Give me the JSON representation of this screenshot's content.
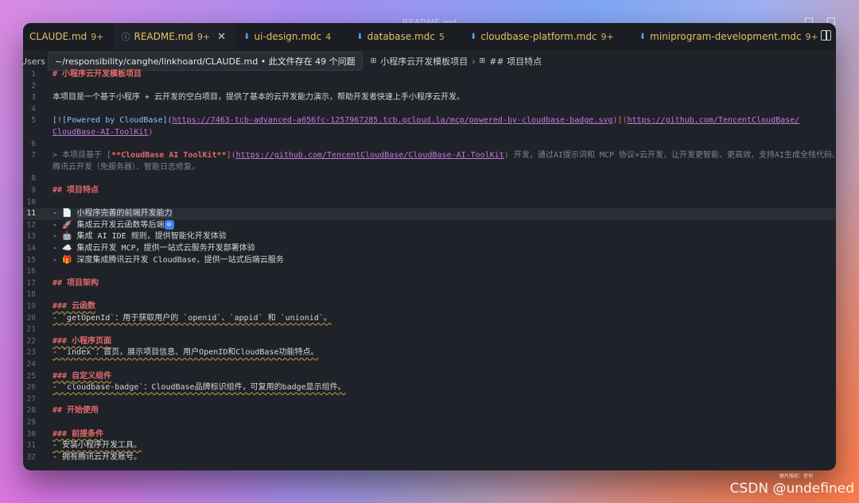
{
  "window_title": "README.md",
  "tabs": [
    {
      "name": "CLAUDE.md",
      "count": "9+",
      "active": false,
      "icon": "markdown-icon"
    },
    {
      "name": "README.md",
      "count": "9+",
      "active": true,
      "icon": "info-icon"
    },
    {
      "name": "ui-design.mdc",
      "count": "4",
      "active": false,
      "icon": "markdown-icon"
    },
    {
      "name": "database.mdc",
      "count": "5",
      "active": false,
      "icon": "markdown-icon"
    },
    {
      "name": "cloudbase-platform.mdc",
      "count": "9+",
      "active": false,
      "icon": "markdown-icon"
    },
    {
      "name": "miniprogram-development.mdc",
      "count": "9+",
      "active": false,
      "icon": "markdown-icon"
    }
  ],
  "breadcrumb": {
    "users": "Users",
    "tooltip": "~/responsibility/canghe/linkhoard/CLAUDE.md • 此文件存在 49 个问题",
    "crumb1": "小程序云开发模板项目",
    "crumb2": "## 项目特点"
  },
  "lines": [
    {
      "n": "1",
      "t": "# 小程序云开发模板项目"
    },
    {
      "n": "2",
      "t": ""
    },
    {
      "n": "3",
      "t": "本项目是一个基于小程序 + 云开发的空白项目，提供了基本的云开发能力演示，帮助开发者快速上手小程序云开发。"
    },
    {
      "n": "4",
      "t": ""
    },
    {
      "n": "5",
      "a": "[![Powered by CloudBase](",
      "b": "https://7463-tcb-advanced-a656fc-1257967285.tcb.qcloud.la/mcp/powered-by-cloudbase-badge.svg",
      "c": ")](",
      "d": "https://github.com/TencentCloudBase/"
    },
    {
      "n": "",
      "d": "CloudBase-AI-ToolKit",
      "c": ")"
    },
    {
      "n": "6",
      "t": ""
    },
    {
      "n": "7",
      "a": "> 本项目基于 [",
      "b": "**CloudBase AI ToolKit**",
      "c": "](",
      "d": "https://github.com/TencentCloudBase/CloudBase-AI-ToolKit",
      "e": ") 开发，通过AI提示词和 MCP 协议+云开发，让开发更智能、更高效，支持AI生成全栈代码、一键"
    },
    {
      "n": "",
      "t": "腾讯云开发（免服务器）、智能日志修复。"
    },
    {
      "n": "8",
      "t": ""
    },
    {
      "n": "9",
      "t": "## 项目特点"
    },
    {
      "n": "10",
      "t": ""
    },
    {
      "n": "11",
      "emoji": "📄",
      "t": "小程序完善的前端开发能力"
    },
    {
      "n": "12",
      "emoji": "🚀",
      "t": "集成云开发云函数等后端"
    },
    {
      "n": "13",
      "emoji": "🤖",
      "t": "集成 AI IDE 规则，提供智能化开发体验"
    },
    {
      "n": "14",
      "emoji": "☁️",
      "t": "集成云开发 MCP，提供一站式云服务开发部署体验"
    },
    {
      "n": "15",
      "emoji": "🎁",
      "t": "深度集成腾讯云开发 CloudBase，提供一站式后端云服务"
    },
    {
      "n": "16",
      "t": ""
    },
    {
      "n": "17",
      "t": "## 项目架构"
    },
    {
      "n": "18",
      "t": ""
    },
    {
      "n": "19",
      "t": "### 云函数"
    },
    {
      "n": "20",
      "t": "- `getOpenId`：用于获取用户的 `openid`、`appid` 和 `unionid`。"
    },
    {
      "n": "21",
      "t": ""
    },
    {
      "n": "22",
      "t": "### 小程序页面"
    },
    {
      "n": "23",
      "t": "- `index`：首页，展示项目信息、用户OpenID和CloudBase功能特点。"
    },
    {
      "n": "24",
      "t": ""
    },
    {
      "n": "25",
      "t": "### 自定义组件"
    },
    {
      "n": "26",
      "t": "- `cloudbase-badge`：CloudBase品牌标识组件，可复用的badge显示组件。"
    },
    {
      "n": "27",
      "t": ""
    },
    {
      "n": "28",
      "t": "## 开始使用"
    },
    {
      "n": "29",
      "t": ""
    },
    {
      "n": "30",
      "t": "### 前提条件"
    },
    {
      "n": "31",
      "t": "- 安装小程序开发工具。"
    },
    {
      "n": "32",
      "t": "- 拥有腾讯云开发账号。"
    }
  ],
  "watermark": "CSDN @undefined",
  "small_mark": "图片版权：苍何"
}
